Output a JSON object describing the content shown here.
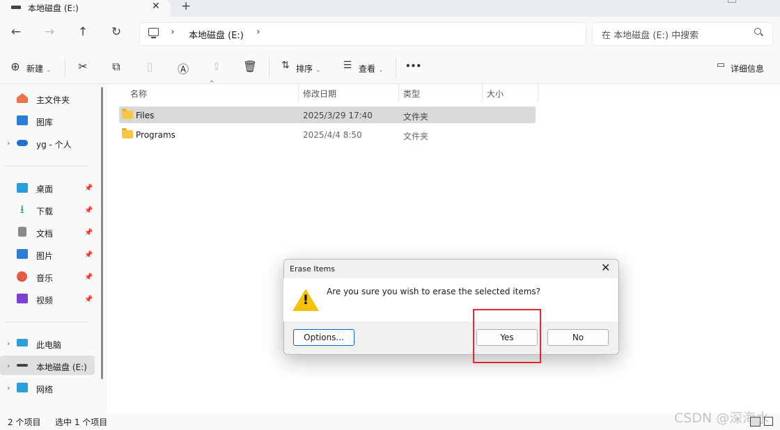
{
  "tab": {
    "title": "本地磁盘 (E:)",
    "close": "✕",
    "add": "+"
  },
  "nav": {
    "back": "←",
    "forward": "→",
    "up": "↑",
    "refresh": "↻"
  },
  "address": {
    "crumb": "本地磁盘 (E:)",
    "sep": "›"
  },
  "search": {
    "placeholder": "在 本地磁盘 (E:) 中搜索"
  },
  "toolbar": {
    "new": "新建",
    "sort": "排序",
    "view": "查看",
    "more": "•••",
    "details": "详细信息",
    "icons": [
      "plus-circle-icon",
      "cut-icon",
      "copy-icon",
      "paste-icon",
      "rename-icon",
      "share-icon",
      "delete-icon",
      "sort-icon",
      "view-icon",
      "more-icon",
      "details-pane-icon"
    ]
  },
  "sidebar": {
    "group1": [
      {
        "label": "主文件夹",
        "icon": "home-icon",
        "color": "#e8744a"
      },
      {
        "label": "图库",
        "icon": "gallery-icon",
        "color": "#2b7bd8"
      },
      {
        "label": "yg - 个人",
        "icon": "onedrive-icon",
        "color": "#1f6fd1"
      }
    ],
    "group2": [
      {
        "label": "桌面",
        "icon": "desktop-icon",
        "color": "#2d9fd8"
      },
      {
        "label": "下载",
        "icon": "download-icon",
        "color": "#1f9a6b"
      },
      {
        "label": "文档",
        "icon": "documents-icon",
        "color": "#7a7a7a"
      },
      {
        "label": "图片",
        "icon": "pictures-icon",
        "color": "#2b7bd8"
      },
      {
        "label": "音乐",
        "icon": "music-icon",
        "color": "#e25a46"
      },
      {
        "label": "视频",
        "icon": "videos-icon",
        "color": "#7b3fd1"
      }
    ],
    "group3": [
      {
        "label": "此电脑",
        "icon": "this-pc-icon",
        "color": "#2d9fd8"
      },
      {
        "label": "本地磁盘 (E:)",
        "icon": "drive-icon",
        "color": "#444444"
      },
      {
        "label": "网络",
        "icon": "network-icon",
        "color": "#2d9fd8"
      }
    ]
  },
  "columns": {
    "name": "名称",
    "modified": "修改日期",
    "type": "类型",
    "size": "大小"
  },
  "files": [
    {
      "name": "Files",
      "modified": "2025/3/29 17:40",
      "type": "文件夹"
    },
    {
      "name": "Programs",
      "modified": "2025/4/4 8:50",
      "type": "文件夹"
    }
  ],
  "status": {
    "count": "2 个项目",
    "selected": "选中 1 个项目"
  },
  "watermark": "CSDN @深海水",
  "dialog": {
    "title": "Erase Items",
    "close": "✕",
    "message": "Are you sure you wish to erase the selected items?",
    "warning_mark": "!",
    "options": "Options...",
    "yes": "Yes",
    "no": "No"
  }
}
